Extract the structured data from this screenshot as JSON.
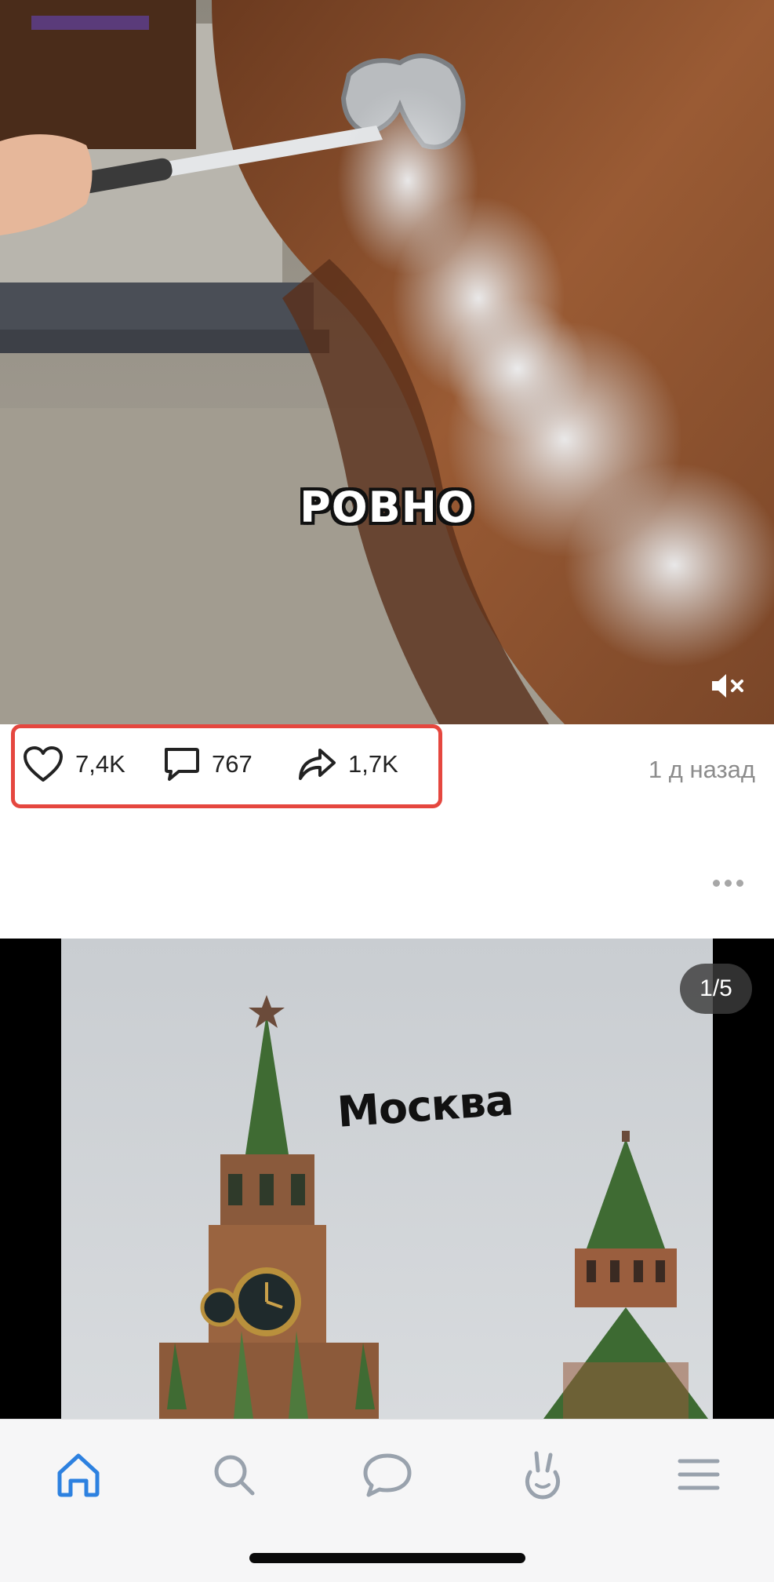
{
  "post1": {
    "subtitle": "РОВНО",
    "mute_icon": "speaker-muted-icon",
    "actions": {
      "likes": "7,4K",
      "comments": "767",
      "shares": "1,7K"
    },
    "time": "1 д назад",
    "highlight_color": "#e5473f"
  },
  "post2": {
    "more_icon": "more-dots-icon",
    "caption": "Москва",
    "page_indicator": "1/5"
  },
  "bottom_nav": {
    "items": [
      {
        "name": "home",
        "icon": "home-icon",
        "active": true
      },
      {
        "name": "search",
        "icon": "search-icon",
        "active": false
      },
      {
        "name": "messages",
        "icon": "chat-bubble-icon",
        "active": false
      },
      {
        "name": "clips",
        "icon": "bunny-icon",
        "active": false
      },
      {
        "name": "menu",
        "icon": "hamburger-icon",
        "active": false
      }
    ],
    "active_color": "#2d81e0",
    "inactive_color": "#99a2ad"
  }
}
